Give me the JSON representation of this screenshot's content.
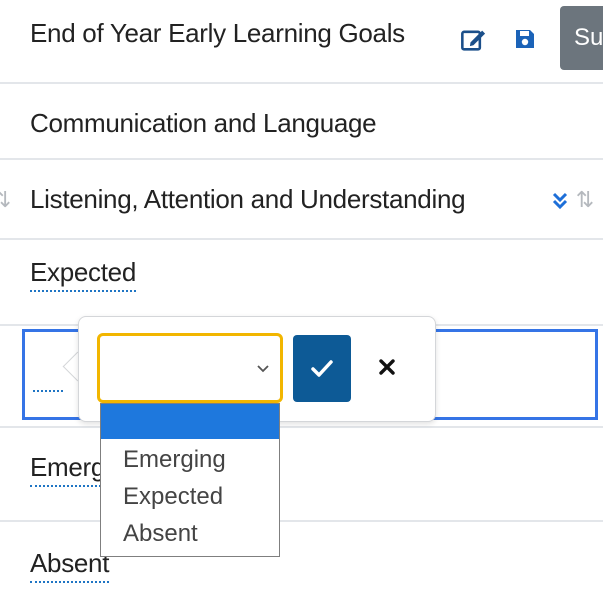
{
  "header": {
    "title": "End of Year Early Learning Goals",
    "submit_label": "Su"
  },
  "sections": {
    "area": "Communication and Language",
    "goal": "Listening, Attention and Understanding"
  },
  "rows": [
    {
      "value": "Expected"
    },
    {
      "value": "Emerg"
    },
    {
      "value": "Absent"
    }
  ],
  "editor": {
    "selected_value": "",
    "options": [
      "",
      "Emerging",
      "Expected",
      "Absent"
    ]
  },
  "colors": {
    "link_underline": "#1f75c4",
    "focus_border": "#f2b600",
    "active_cell_border": "#3574e6",
    "confirm_button": "#0d5a96",
    "option_highlight": "#1e78dd",
    "submit_button": "#6c757d"
  },
  "icons": {
    "edit": "edit-icon",
    "save": "save-icon",
    "expand": "double-chevron-down-icon",
    "sort": "sort-icon",
    "confirm": "check-icon",
    "cancel": "close-icon"
  }
}
